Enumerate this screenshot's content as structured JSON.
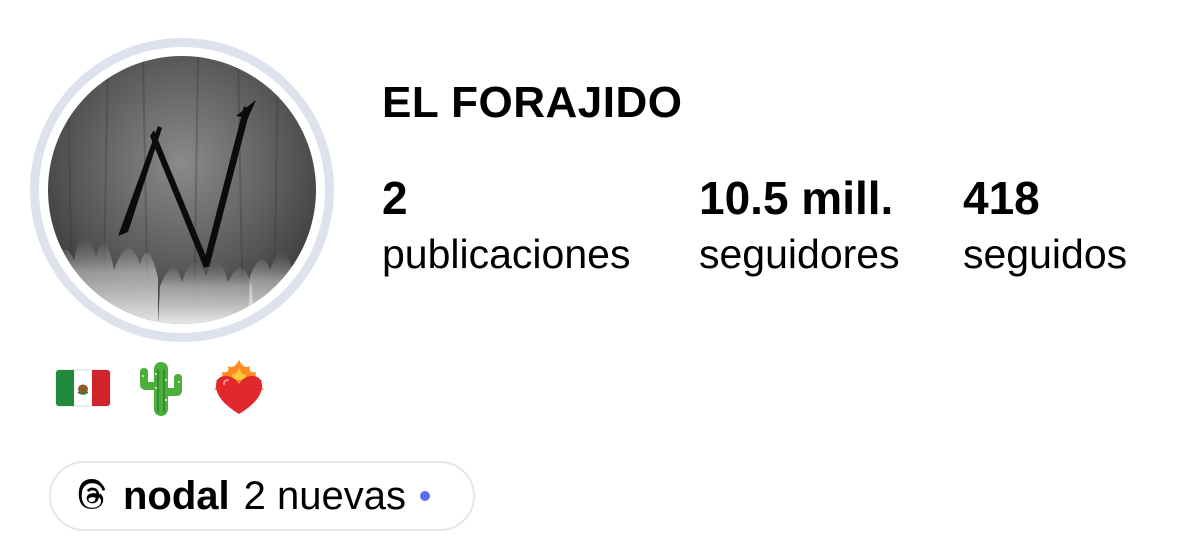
{
  "profile": {
    "username": "EL FORAJIDO",
    "avatar_icon": "dark-smoke-letter-n-avatar",
    "avatar_ring_color": "#dde2ec"
  },
  "stats": {
    "posts": {
      "value": "2",
      "label": "publicaciones"
    },
    "followers": {
      "value": "10.5 mill.",
      "label": "seguidores"
    },
    "following": {
      "value": "418",
      "label": "seguidos"
    }
  },
  "bio": {
    "emojis": [
      "mexico-flag-icon",
      "cactus-icon",
      "heart-on-fire-icon"
    ]
  },
  "threads_badge": {
    "icon": "threads-icon",
    "name": "nodal",
    "new_label": "2 nuevas",
    "dot_color": "#5b6ef5"
  }
}
